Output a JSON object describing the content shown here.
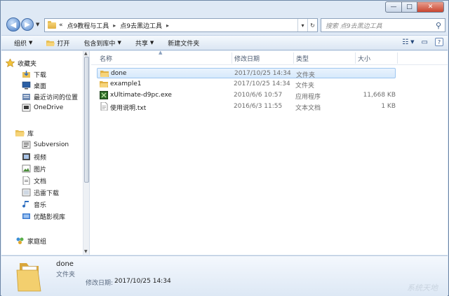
{
  "window": {
    "controls": {
      "minimize": "—",
      "maximize": "□",
      "close": "✕"
    }
  },
  "address": {
    "overflow": "«",
    "crumbs": [
      "点9教程与工具",
      "点9去黑边工具"
    ],
    "separator": "▸",
    "history_drop": "▾",
    "refresh": "↻"
  },
  "search": {
    "placeholder": "搜索 点9去黑边工具",
    "icon": "search-icon"
  },
  "toolbar": {
    "organize": "组织",
    "open": "打开",
    "include_in_library": "包含到库中",
    "share": "共享",
    "new_folder": "新建文件夹",
    "dropdown_arrow": "▼"
  },
  "nav": {
    "favorites": {
      "header": "收藏夹",
      "items": [
        "下载",
        "桌面",
        "最近访问的位置",
        "OneDrive"
      ]
    },
    "libraries": {
      "header": "库",
      "items": [
        "Subversion",
        "视频",
        "图片",
        "文档",
        "迅雷下载",
        "音乐",
        "优酷影视库"
      ]
    },
    "homegroup": "家庭组"
  },
  "columns": {
    "name": "名称",
    "modified": "修改日期",
    "type": "类型",
    "size": "大小"
  },
  "files": [
    {
      "name": "done",
      "modified": "2017/10/25 14:34",
      "type": "文件夹",
      "size": "",
      "icon": "folder-icon",
      "selected": true
    },
    {
      "name": "example1",
      "modified": "2017/10/25 14:34",
      "type": "文件夹",
      "size": "",
      "icon": "folder-icon",
      "selected": false
    },
    {
      "name": "xUltimate-d9pc.exe",
      "modified": "2010/6/6 10:57",
      "type": "应用程序",
      "size": "11,668 KB",
      "icon": "exe-icon",
      "selected": false
    },
    {
      "name": "使用说明.txt",
      "modified": "2016/6/3 11:55",
      "type": "文本文档",
      "size": "1 KB",
      "icon": "text-file-icon",
      "selected": false
    }
  ],
  "details": {
    "name": "done",
    "type": "文件夹",
    "modified_label": "修改日期:",
    "modified_value": "2017/10/25 14:34"
  },
  "watermark": "系统天地",
  "colors": {
    "selection": "#d6e9fc",
    "selection_border": "#9ec6f0",
    "folder": "#e8bf56",
    "accent": "#3e76c2"
  }
}
